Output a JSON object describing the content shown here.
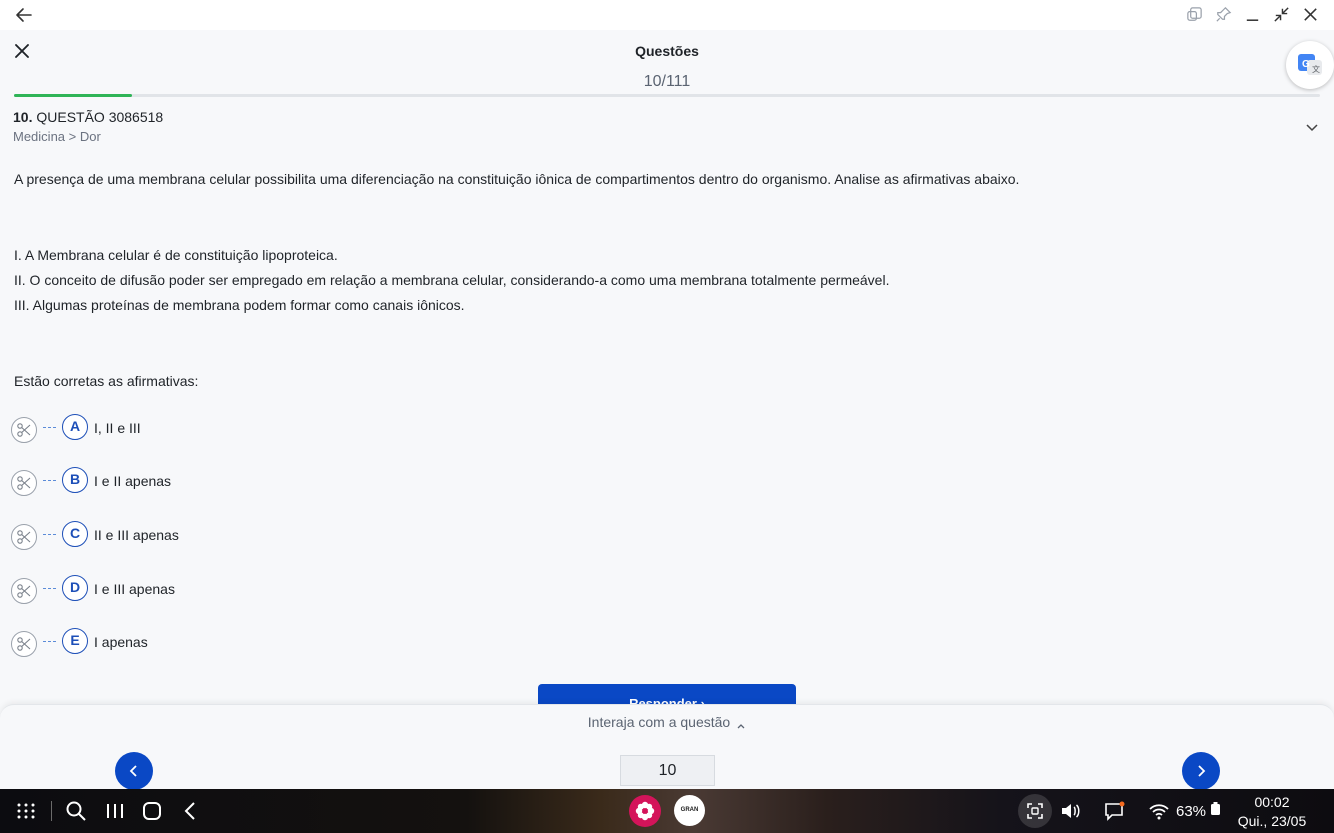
{
  "header": {
    "title": "Questões",
    "counter": "10/111",
    "progress_fraction": 0.09
  },
  "question": {
    "number": "10.",
    "code": " QUESTÃO 3086518",
    "breadcrumb": "Medicina > Dor",
    "statement": "A presença de uma membrana celular possibilita uma diferenciação na constituição iônica de compartimentos dentro do organismo. Analise as afirmativas abaixo.",
    "items": [
      "I. A Membrana celular é de constituição lipoproteica.",
      "II. O conceito de difusão poder ser empregado em relação a membrana celular, considerando-a como uma membrana totalmente permeável.",
      "III. Algumas proteínas de membrana podem formar como canais iônicos."
    ],
    "prompt": "Estão corretas as afirmativas:",
    "options": [
      {
        "letter": "A",
        "text": "I, II e III"
      },
      {
        "letter": "B",
        "text": "I e II apenas"
      },
      {
        "letter": "C",
        "text": "II e III apenas"
      },
      {
        "letter": "D",
        "text": "I e III apenas"
      },
      {
        "letter": "E",
        "text": "I apenas"
      }
    ]
  },
  "footer": {
    "respond_label": "Responder",
    "interact_label": "Interaja com a questão",
    "page_value": "10"
  },
  "taskbar": {
    "app2_label": "GRAN",
    "battery": "63%",
    "time": "00:02",
    "date": "Qui., 23/05"
  },
  "colors": {
    "accent": "#0a48c5",
    "progress": "#2fb457"
  },
  "icons": {
    "back": "arrow-left-icon",
    "close": "close-icon",
    "translate": "google-translate-icon",
    "collapse": "chevron-down-icon",
    "eliminate": "scissors-icon",
    "prev": "chevron-left-icon",
    "next": "chevron-right-icon"
  }
}
